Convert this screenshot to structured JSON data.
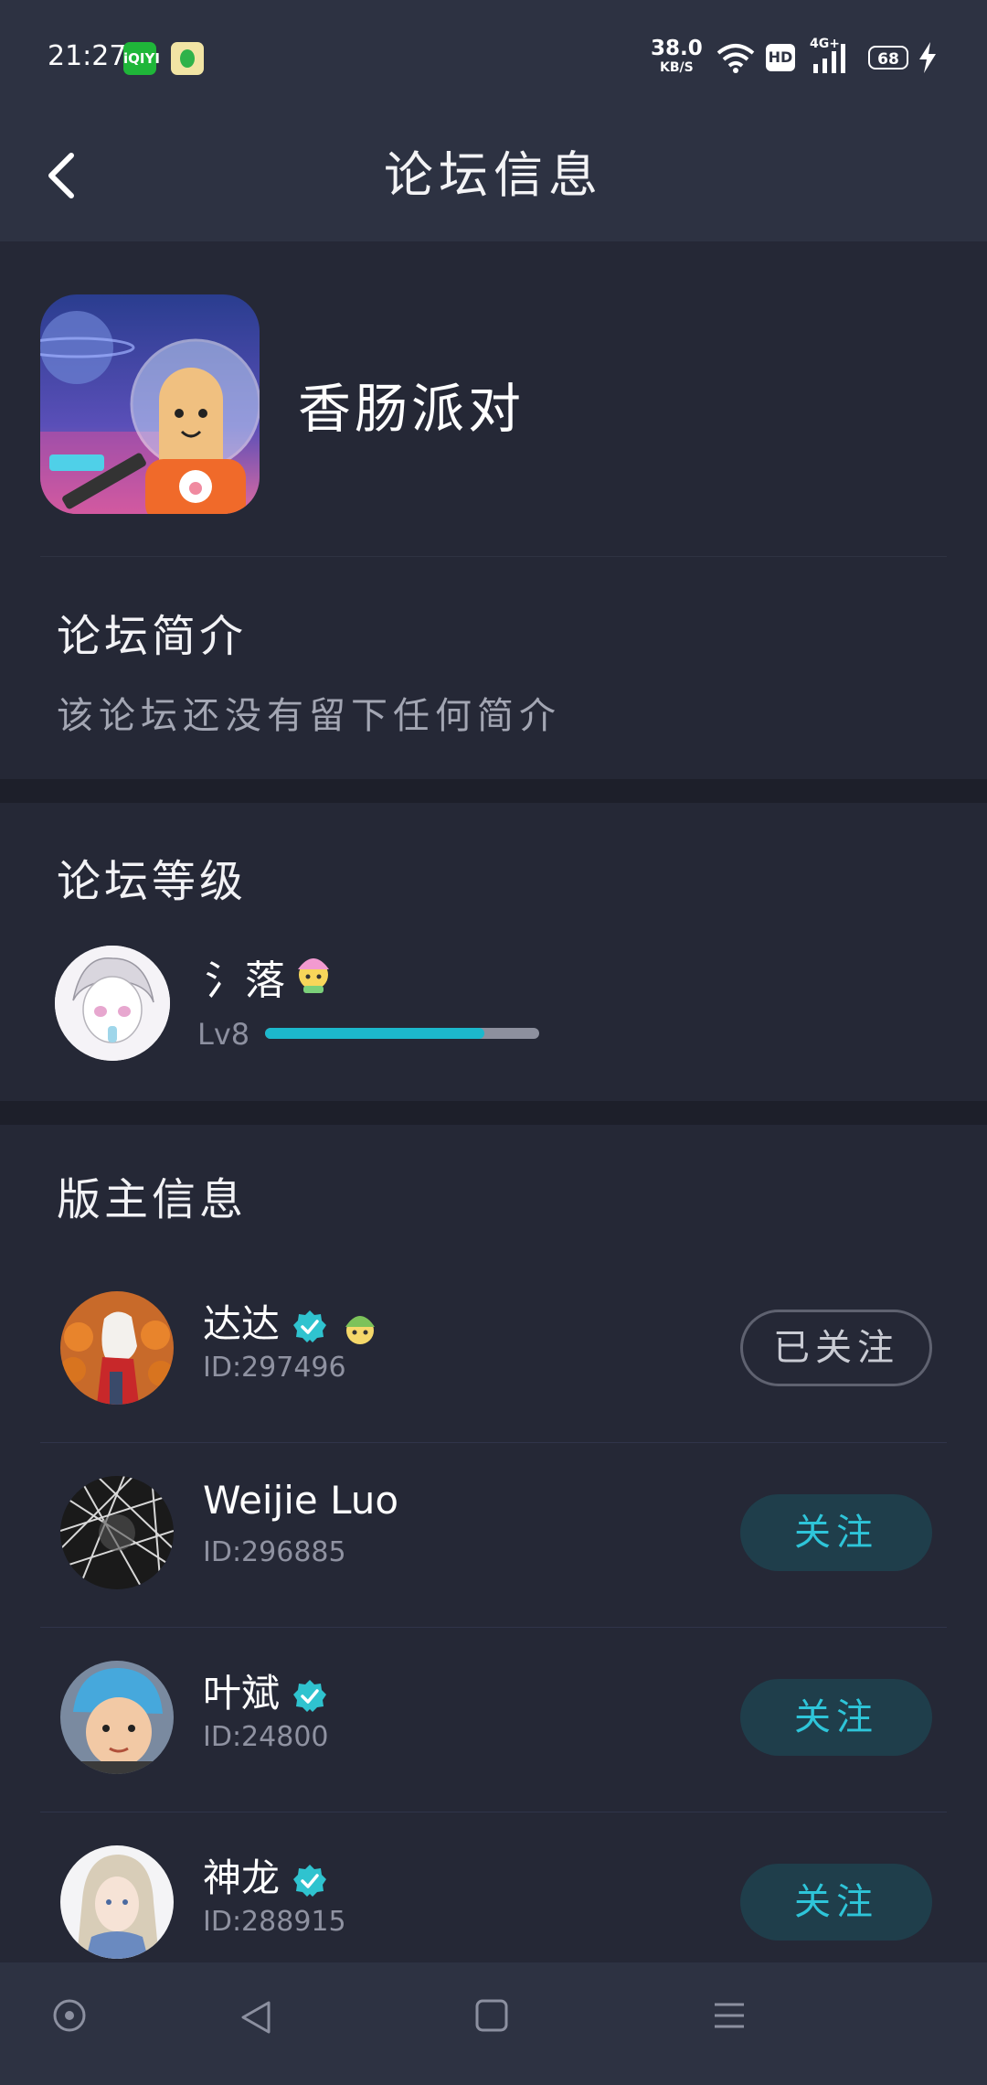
{
  "status_bar": {
    "time": "21:27",
    "iqiyi_icon": "iqiyi-app-icon",
    "music_icon": "qq-music-app-icon",
    "net_speed_value": "38.0",
    "net_speed_unit": "KB/S",
    "hd_label": "HD",
    "network_label": "4G+",
    "battery_level": "68"
  },
  "header": {
    "back_icon": "chevron-left-icon",
    "title": "论坛信息"
  },
  "forum": {
    "name": "香肠派对"
  },
  "intro": {
    "title": "论坛简介",
    "text": "该论坛还没有留下任何简介"
  },
  "level": {
    "title": "论坛等级",
    "user_name": "氵落",
    "level_label": "Lv8",
    "progress": 0.8,
    "accent_color": "#1cb8cc"
  },
  "moderators": {
    "title": "版主信息",
    "items": [
      {
        "name": "达达",
        "id": "ID:297496",
        "button": "已关注",
        "verified": true,
        "followed": true
      },
      {
        "name": "Weijie  Luo",
        "id": "ID:296885",
        "button": "关注",
        "verified": false,
        "followed": false
      },
      {
        "name": "叶斌",
        "id": "ID:24800",
        "button": "关注",
        "verified": true,
        "followed": false
      },
      {
        "name": "神龙",
        "id": "ID:288915",
        "button": "关注",
        "verified": true,
        "followed": false
      }
    ]
  },
  "nav_bar": {
    "icons": [
      "home-circle-icon",
      "back-triangle-icon",
      "home-square-icon",
      "menu-icon"
    ]
  }
}
